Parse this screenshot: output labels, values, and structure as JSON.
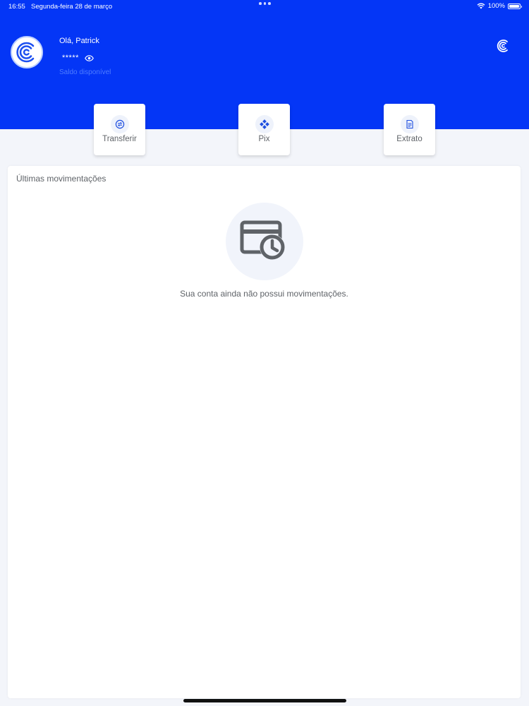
{
  "status_bar": {
    "time": "16:55",
    "date": "Segunda-feira 28 de março",
    "battery": "100%",
    "icons": [
      "wifi-icon",
      "battery-icon"
    ]
  },
  "header": {
    "greeting": "Olá, Patrick",
    "balance_masked": "*****",
    "balance_label": "Saldo disponível",
    "brand_color": "#0436f6"
  },
  "actions": [
    {
      "label": "Transferir",
      "icon": "transfer-icon"
    },
    {
      "label": "Pix",
      "icon": "pix-icon"
    },
    {
      "label": "Extrato",
      "icon": "statement-icon"
    }
  ],
  "movements": {
    "title": "Últimas movimentações",
    "empty_message": "Sua conta ainda não possui movimentações.",
    "empty_icon": "card-clock-icon"
  }
}
